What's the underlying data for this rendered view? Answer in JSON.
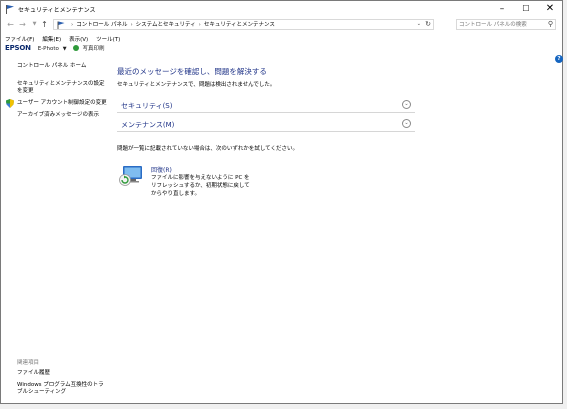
{
  "window": {
    "title": "セキュリティとメンテナンス"
  },
  "address": {
    "breadcrumbs": [
      "コントロール パネル",
      "システムとセキュリティ",
      "セキュリティとメンテナンス"
    ],
    "search_placeholder": "コントロール パネルの検索"
  },
  "menubar": {
    "items": [
      "ファイル(F)",
      "編集(E)",
      "表示(V)",
      "ツール(T)"
    ]
  },
  "toolbar": {
    "brand": "EPSON",
    "app": "E-Photo",
    "print": "写真印刷"
  },
  "sidebar": {
    "home": "コントロール パネル ホーム",
    "settings": "セキュリティとメンテナンスの設定を変更",
    "uac": "ユーザー アカウント制御設定の変更",
    "archive": "アーカイブ済みメッセージの表示",
    "related_heading": "関連項目",
    "file_history": "ファイル履歴",
    "troubleshoot": "Windows プログラム互換性のトラブルシューティング"
  },
  "main": {
    "title": "最近のメッセージを確認し、問題を解決する",
    "subtitle": "セキュリティとメンテナンスで、問題は検出されませんでした。",
    "sections": [
      "セキュリティ(S)",
      "メンテナンス(M)"
    ],
    "note": "問題が一覧に記載されていない場合は、次のいずれかを試してください。",
    "recovery_title": "回復(R)",
    "recovery_desc": "ファイルに影響を与えないように PC をリフレッシュするか、初期状態に戻してからやり直します。"
  },
  "colors": {
    "link": "#1e3287",
    "epson": "#0b2a6d"
  }
}
